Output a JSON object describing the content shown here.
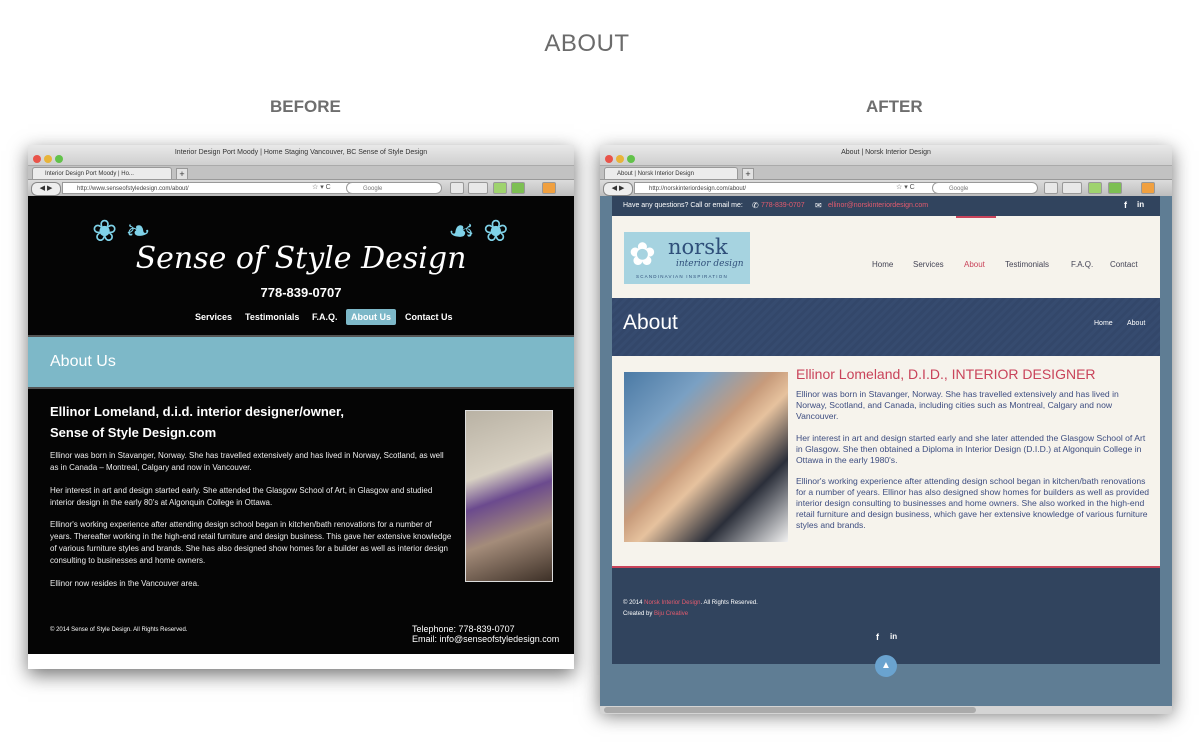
{
  "page_title": "ABOUT",
  "before_label": "BEFORE",
  "after_label": "AFTER",
  "before": {
    "window_title": "Interior Design Port Moody | Home Staging Vancouver, BC Sense of Style Design",
    "tab_label": "Interior Design Port Moody | Ho...",
    "url": "http://www.senseofstyledesign.com/about/",
    "search_placeholder": "Google",
    "logo_text": "Sense of Style Design",
    "phone": "778-839-0707",
    "nav": [
      "Services",
      "Testimonials",
      "F.A.Q.",
      "About Us",
      "Contact Us"
    ],
    "banner_title": "About Us",
    "heading_line1": "Ellinor Lomeland, d.i.d. interior designer/owner,",
    "heading_line2": "Sense of Style Design.com",
    "paragraphs": [
      "Ellinor was born in Stavanger, Norway. She has travelled extensively and has lived in Norway, Scotland, as well as in Canada – Montreal, Calgary and now in Vancouver.",
      "Her interest in art and design started early. She attended the Glasgow School of Art, in Glasgow and studied interior design in the early 80’s at Algonquin College in Ottawa.",
      "Ellinor's working experience after attending design school began in kitchen/bath renovations for a number of years. Thereafter working in the high-end retail furniture and design business. This gave her extensive knowledge of various furniture styles and brands. She has also designed show homes for a builder as well as interior design consulting to businesses and home owners.",
      "Ellinor now resides in the Vancouver area."
    ],
    "copyright": "© 2014 Sense of Style Design. All Rights Reserved.",
    "footer_phone": "Telephone: 778-839-0707",
    "footer_email": "Email: info@senseofstyledesign.com"
  },
  "after": {
    "window_title": "About | Norsk Interior Design",
    "tab_label": "About | Norsk Interior Design",
    "url": "http://norskinteriordesign.com/about/",
    "search_placeholder": "Google",
    "topbar_question": "Have any questions? Call or email me:",
    "topbar_phone": "778-839-0707",
    "topbar_email": "ellinor@norskinteriordesign.com",
    "logo_main": "norsk",
    "logo_sub": "interior design",
    "logo_tag": "SCANDINAVIAN INSPIRATION",
    "nav": [
      "Home",
      "Services",
      "About",
      "Testimonials",
      "F.A.Q.",
      "Contact"
    ],
    "banner_title": "About",
    "breadcrumb": [
      "Home",
      "About"
    ],
    "heading": "Ellinor Lomeland, D.I.D., INTERIOR DESIGNER",
    "paragraphs": [
      "Ellinor was born in Stavanger, Norway. She has travelled extensively and has lived in Norway, Scotland, and Canada, including cities such as Montreal, Calgary and now Vancouver.",
      "Her interest in art and design started early and she later attended the Glasgow School of Art in Glasgow. She then obtained a Diploma in Interior Design (D.I.D.) at Algonquin College in Ottawa in the early 1980's.",
      "Ellinor's working experience after attending design school began in kitchen/bath renovations for a number of years. Ellinor has also designed show homes for builders as well as provided interior design consulting to businesses and home owners. She also worked in the high-end retail furniture and design business, which gave her extensive knowledge of various furniture styles and brands."
    ],
    "footer_copy_prefix": "© 2014",
    "footer_copy_brand": "Norsk Interior Design",
    "footer_copy_suffix": ". All Rights Reserved.",
    "footer_created_prefix": "Created by",
    "footer_created_brand": "Biju Creative"
  },
  "colors": {
    "before_accent": "#7db8c8",
    "after_accent": "#c9435a",
    "after_navy": "#31445e"
  }
}
